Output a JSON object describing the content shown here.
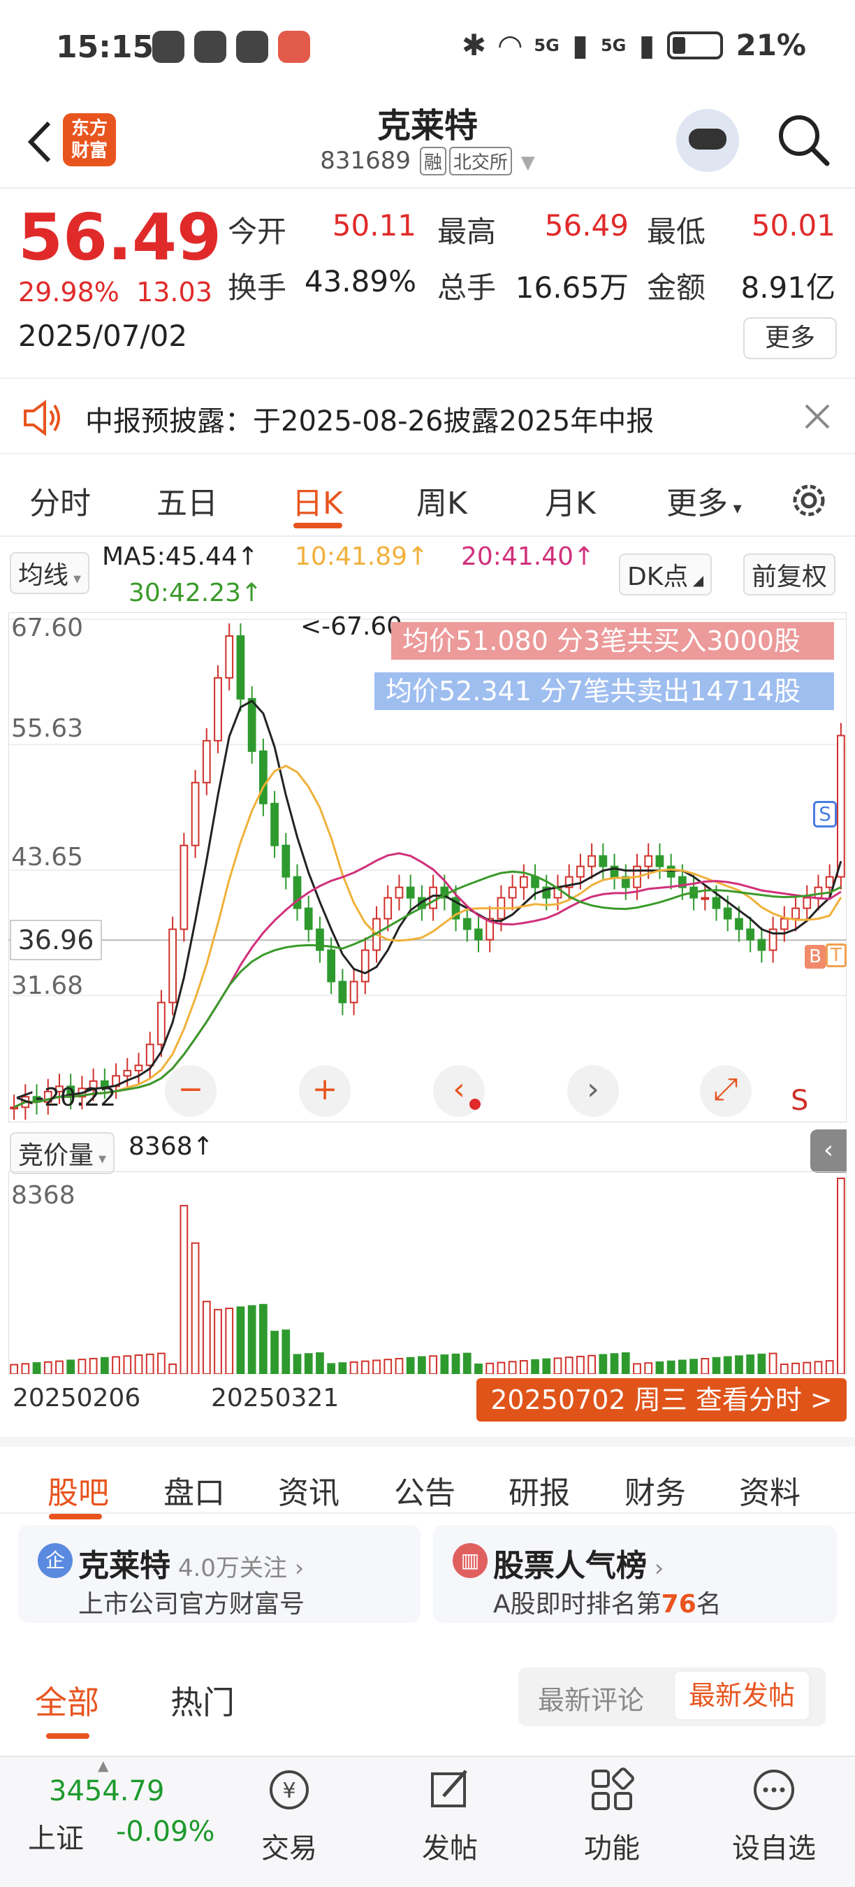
{
  "status_bar": {
    "time": "15:15",
    "battery": "21%",
    "signal_labels": [
      "5G",
      "5G"
    ]
  },
  "header": {
    "logo_text": "东方财富",
    "title": "克莱特",
    "code": "831689",
    "tags": [
      "融",
      "北交所"
    ]
  },
  "quote": {
    "price": "56.49",
    "change_pct": "29.98%",
    "change_amt": "13.03",
    "date": "2025/07/02",
    "fields": [
      {
        "label": "今开",
        "value": "50.11"
      },
      {
        "label": "最高",
        "value": "56.49"
      },
      {
        "label": "最低",
        "value": "50.01"
      },
      {
        "label": "换手",
        "value": "43.89%"
      },
      {
        "label": "总手",
        "value": "16.65万"
      },
      {
        "label": "金额",
        "value": "8.91亿"
      }
    ],
    "more_label": "更多"
  },
  "notice": {
    "text": "中报预披露：于2025-08-26披露2025年中报"
  },
  "period_tabs": [
    "分时",
    "五日",
    "日K",
    "周K",
    "月K",
    "更多"
  ],
  "ma_row": {
    "type_label": "均线",
    "ma5": "MA5:45.44↑",
    "ma10": "10:41.89↑",
    "ma20": "20:41.40↑",
    "ma30": "30:42.23↑",
    "dk_label": "DK点",
    "adjust_label": "前复权"
  },
  "chart": {
    "y_labels": [
      "67.60",
      "55.63",
      "43.65",
      "31.68"
    ],
    "high_label": "<-67.60",
    "low_label": "<-20.22",
    "current_price_label": "36.96",
    "buy_text": "均价51.080  分3笔共买入3000股",
    "sell_text": "均价52.341  分7笔共卖出14714股",
    "marker_s": "S",
    "markers_bt": [
      "B",
      "T"
    ]
  },
  "volume": {
    "type_label": "竞价量",
    "value": "8368↑",
    "max_label": "8368",
    "x_labels": [
      "20250206",
      "20250321"
    ],
    "time_button": "20250702 周三 查看分时 >"
  },
  "section_tabs": [
    "股吧",
    "盘口",
    "资讯",
    "公告",
    "研报",
    "财务",
    "资料"
  ],
  "cards": [
    {
      "icon": "企",
      "title": "克莱特",
      "follow": "4.0万关注",
      "sub": "上市公司官方财富号"
    },
    {
      "title": "股票人气榜",
      "sub_prefix": "A股即时排名第",
      "rank": "76",
      "sub_suffix": "名"
    }
  ],
  "filter": {
    "tabs": [
      "全部",
      "热门"
    ],
    "sort": [
      "最新评论",
      "最新发帖"
    ]
  },
  "bottom_nav": {
    "index_value": "3454.79",
    "index_name": "上证",
    "index_change": "-0.09%",
    "items": [
      "交易",
      "发帖",
      "功能",
      "设自选"
    ]
  },
  "chart_data": {
    "type": "candlestick",
    "y_range": [
      20.22,
      67.6
    ],
    "y_ticks": [
      "67.60",
      "55.63",
      "43.65",
      "31.68"
    ],
    "x_labels": [
      "20250206",
      "20250321"
    ],
    "moving_averages": [
      {
        "name": "MA5",
        "value": 45.44,
        "color": "#222222"
      },
      {
        "name": "10",
        "value": 41.89,
        "color": "#f0b13a"
      },
      {
        "name": "20",
        "value": 41.4,
        "color": "#d0307a"
      },
      {
        "name": "30",
        "value": 42.23,
        "color": "#3a9a2a"
      }
    ],
    "high": 67.6,
    "low": 20.22,
    "last_close": 56.49,
    "volume_max": 8368
  }
}
